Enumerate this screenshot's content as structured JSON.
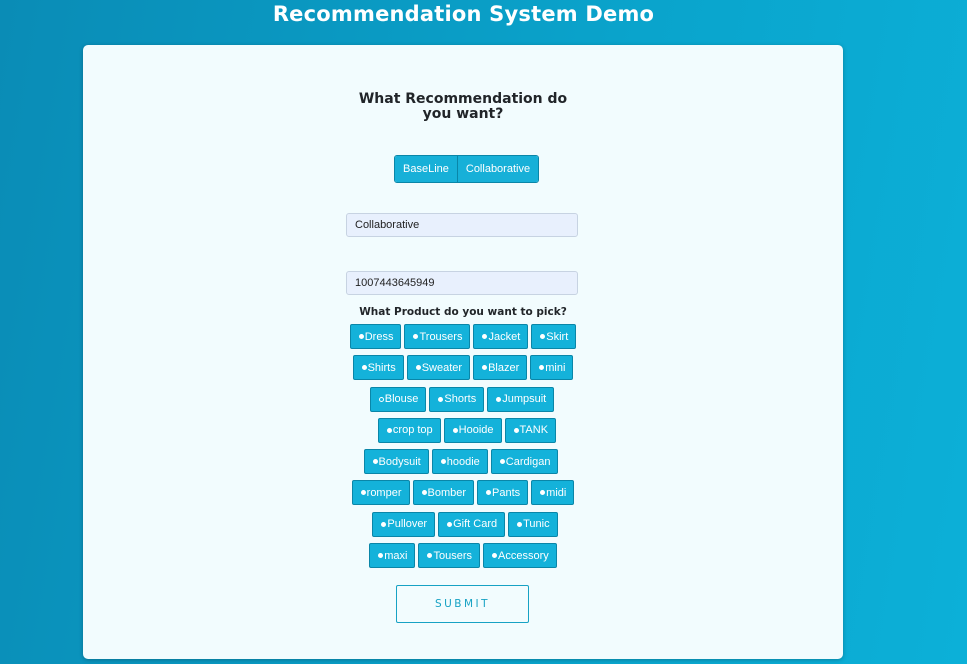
{
  "header": {
    "title": "Recommendation System Demo"
  },
  "form": {
    "question": "What Recommendation do you want?",
    "toggle": {
      "options": [
        "BaseLine",
        "Collaborative"
      ]
    },
    "method_field": {
      "value": "Collaborative"
    },
    "user_id_field": {
      "value": "1007443645949"
    },
    "product_question": "What Product do you want to pick?",
    "products": [
      [
        "Dress",
        "Trousers",
        "Jacket",
        "Skirt"
      ],
      [
        "Shirts",
        "Sweater",
        "Blazer",
        "mini"
      ],
      [
        "Blouse",
        "Shorts",
        "Jumpsuit"
      ],
      [
        "crop top",
        "Hooide",
        "TANK"
      ],
      [
        "Bodysuit",
        "hoodie",
        "Cardigan"
      ],
      [
        "romper",
        "Bomber",
        "Pants",
        "midi"
      ],
      [
        "Pullover",
        "Gift Card",
        "Tunic"
      ],
      [
        "maxi",
        "Tousers",
        "Accessory"
      ]
    ],
    "selected_product": "Blouse",
    "submit_label": "SUBMIT"
  },
  "colors": {
    "background": "#0aa4cc",
    "card": "#f2fcfe",
    "accent": "#14b2da",
    "accent_border": "#0a86a8"
  }
}
